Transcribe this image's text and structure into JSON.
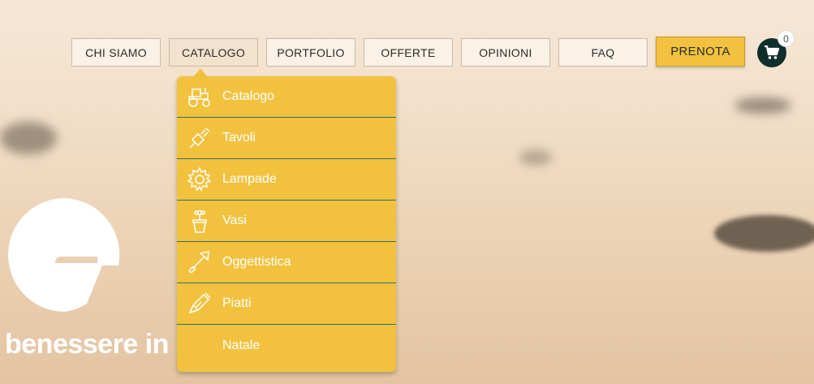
{
  "nav": {
    "items": [
      {
        "label": "CHI SIAMO"
      },
      {
        "label": "CATALOGO"
      },
      {
        "label": "PORTFOLIO"
      },
      {
        "label": "OFFERTE"
      },
      {
        "label": "OPINIONI"
      },
      {
        "label": "FAQ"
      }
    ],
    "cta_label": "PRENOTA",
    "cart_count": "0"
  },
  "dropdown": {
    "items": [
      {
        "label": "Catalogo",
        "icon": "tractor-icon"
      },
      {
        "label": "Tavoli",
        "icon": "plug-icon"
      },
      {
        "label": "Lampade",
        "icon": "gear-icon"
      },
      {
        "label": "Vasi",
        "icon": "flower-pot-icon"
      },
      {
        "label": "Oggettistica",
        "icon": "trowel-icon"
      },
      {
        "label": "Piatti",
        "icon": "paint-tube-icon"
      },
      {
        "label": "Natale",
        "icon": ""
      }
    ]
  },
  "hero": {
    "tagline": "benessere in"
  },
  "colors": {
    "accent": "#f2c23f",
    "dark": "#0f2f2c",
    "divider": "#2f6e66"
  }
}
